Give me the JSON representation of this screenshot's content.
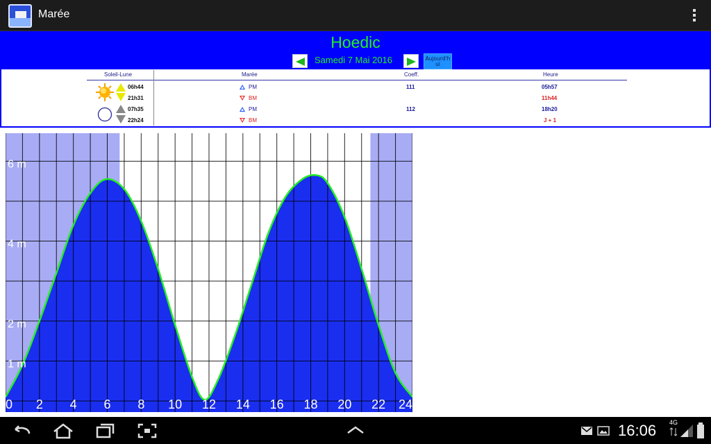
{
  "app": {
    "title": "Marée",
    "icon": "app-lighthouse-icon",
    "menu_icon": "overflow-menu-icon"
  },
  "header": {
    "location": "Hoedic",
    "date": "Samedi 7 Mai 2016",
    "today_button": "Aujourd'h ui",
    "prev_icon": "arrow-left-icon",
    "next_icon": "arrow-right-icon",
    "background_color": "#0000ff",
    "text_color": "#22ee22"
  },
  "table": {
    "headers": {
      "sun_moon": "Soleil-Lune",
      "tide": "Marée",
      "coeff": "Coeff.",
      "time": "Heure"
    },
    "sun": {
      "rise": "06h44",
      "set": "21h31",
      "icon": "sun-icon"
    },
    "moon": {
      "rise": "07h35",
      "set": "22h24",
      "icon": "new-moon-icon"
    },
    "rows": [
      {
        "type": "PM",
        "coeff": "111",
        "time": "05h57",
        "kind": "high"
      },
      {
        "type": "BM",
        "coeff": "",
        "time": "11h44",
        "kind": "low"
      },
      {
        "type": "PM",
        "coeff": "112",
        "time": "18h20",
        "kind": "high"
      },
      {
        "type": "BM",
        "coeff": "",
        "time": "J + 1",
        "kind": "low"
      }
    ]
  },
  "chart_data": {
    "type": "area",
    "title": "",
    "xlabel": "",
    "ylabel": "",
    "x_ticks": [
      "0",
      "2",
      "4",
      "6",
      "8",
      "10",
      "12",
      "14",
      "16",
      "18",
      "20",
      "22",
      "24"
    ],
    "y_ticks": [
      "1 m",
      "2 m",
      "4 m",
      "6 m"
    ],
    "xlim": [
      0,
      24
    ],
    "ylim": [
      0,
      6.7
    ],
    "grid": true,
    "night_shading": [
      [
        0,
        6.73
      ],
      [
        21.52,
        24
      ]
    ],
    "series": [
      {
        "x": [
          0,
          1,
          2,
          3,
          4,
          5,
          5.95,
          7,
          8,
          9,
          10,
          11,
          11.74,
          12.5,
          13.5,
          14.5,
          15.5,
          16.5,
          17.5,
          18.33,
          19,
          20,
          21,
          22,
          23,
          24
        ],
        "values": [
          0.1,
          0.9,
          2.0,
          3.2,
          4.4,
          5.2,
          5.55,
          5.3,
          4.5,
          3.3,
          1.9,
          0.6,
          0.03,
          0.5,
          1.6,
          2.9,
          4.2,
          5.1,
          5.55,
          5.65,
          5.45,
          4.6,
          3.3,
          1.9,
          0.7,
          0.1
        ],
        "fill_color": "#1a2ef0",
        "line_color": "#22ee22"
      }
    ],
    "night_color": "#a8acf4"
  },
  "status_bar": {
    "time": "16:06",
    "network": "4G",
    "icons": [
      "back-icon",
      "home-icon",
      "recent-apps-icon",
      "screenshot-icon",
      "up-chevron-icon",
      "gmail-icon",
      "gallery-icon",
      "signal-icon",
      "battery-icon"
    ]
  }
}
